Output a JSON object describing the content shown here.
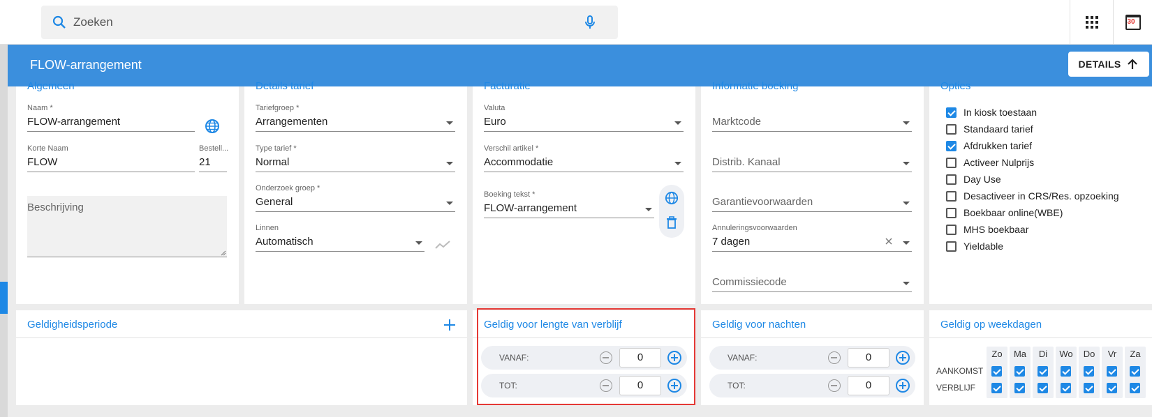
{
  "search": {
    "placeholder": "Zoeken"
  },
  "header": {
    "title": "FLOW-arrangement",
    "details_label": "DETAILS"
  },
  "calendar_day": "30",
  "algemeen": {
    "title": "Algemeen",
    "naam_label": "Naam *",
    "naam_value": "FLOW-arrangement",
    "korte_naam_label": "Korte Naam",
    "korte_naam_value": "FLOW",
    "bestell_label": "Bestell...",
    "bestell_value": "21",
    "beschrijving_placeholder": "Beschrijving"
  },
  "details_tarief": {
    "title": "Details tarief",
    "tariefgroep_label": "Tariefgroep *",
    "tariefgroep_value": "Arrangementen",
    "type_label": "Type tarief *",
    "type_value": "Normal",
    "onderzoek_label": "Onderzoek groep *",
    "onderzoek_value": "General",
    "linnen_label": "Linnen",
    "linnen_value": "Automatisch"
  },
  "facturatie": {
    "title": "Facturatie",
    "valuta_label": "Valuta",
    "valuta_value": "Euro",
    "verschil_label": "Verschil artikel *",
    "verschil_value": "Accommodatie",
    "boeking_label": "Boeking tekst *",
    "boeking_value": "FLOW-arrangement"
  },
  "informatie": {
    "title": "Informatie boeking",
    "marktcode": "Marktcode",
    "distrib": "Distrib. Kanaal",
    "garantie": "Garantievoorwaarden",
    "annulering_label": "Annuleringsvoorwaarden",
    "annulering_value": "7 dagen",
    "commissie": "Commissiecode"
  },
  "opties": {
    "title": "Opties",
    "items": [
      {
        "label": "In kiosk toestaan",
        "checked": true
      },
      {
        "label": "Standaard tarief",
        "checked": false
      },
      {
        "label": "Afdrukken tarief",
        "checked": true
      },
      {
        "label": "Activeer Nulprijs",
        "checked": false
      },
      {
        "label": "Day Use",
        "checked": false
      },
      {
        "label": "Desactiveer in CRS/Res. opzoeking",
        "checked": false
      },
      {
        "label": "Boekbaar online(WBE)",
        "checked": false
      },
      {
        "label": "MHS boekbaar",
        "checked": false
      },
      {
        "label": "Yieldable",
        "checked": false
      }
    ]
  },
  "geldigheid": {
    "title": "Geldigheidsperiode"
  },
  "lengte": {
    "title": "Geldig voor lengte van verblijf",
    "vanaf_label": "VANAF:",
    "vanaf_value": "0",
    "tot_label": "TOT:",
    "tot_value": "0"
  },
  "nachten": {
    "title": "Geldig voor nachten",
    "vanaf_label": "VANAF:",
    "vanaf_value": "0",
    "tot_label": "TOT:",
    "tot_value": "0"
  },
  "weekdagen": {
    "title": "Geldig op weekdagen",
    "days": [
      "Zo",
      "Ma",
      "Di",
      "Wo",
      "Do",
      "Vr",
      "Za"
    ],
    "row_labels": [
      "AANKOMST",
      "VERBLIJF"
    ],
    "aankomst": [
      true,
      true,
      true,
      true,
      true,
      true,
      true
    ],
    "verblijf": [
      true,
      true,
      true,
      true,
      true,
      true,
      true
    ]
  },
  "colors": {
    "accent": "#1e88e5",
    "header": "#3b8fdd",
    "highlight": "#e53935"
  }
}
